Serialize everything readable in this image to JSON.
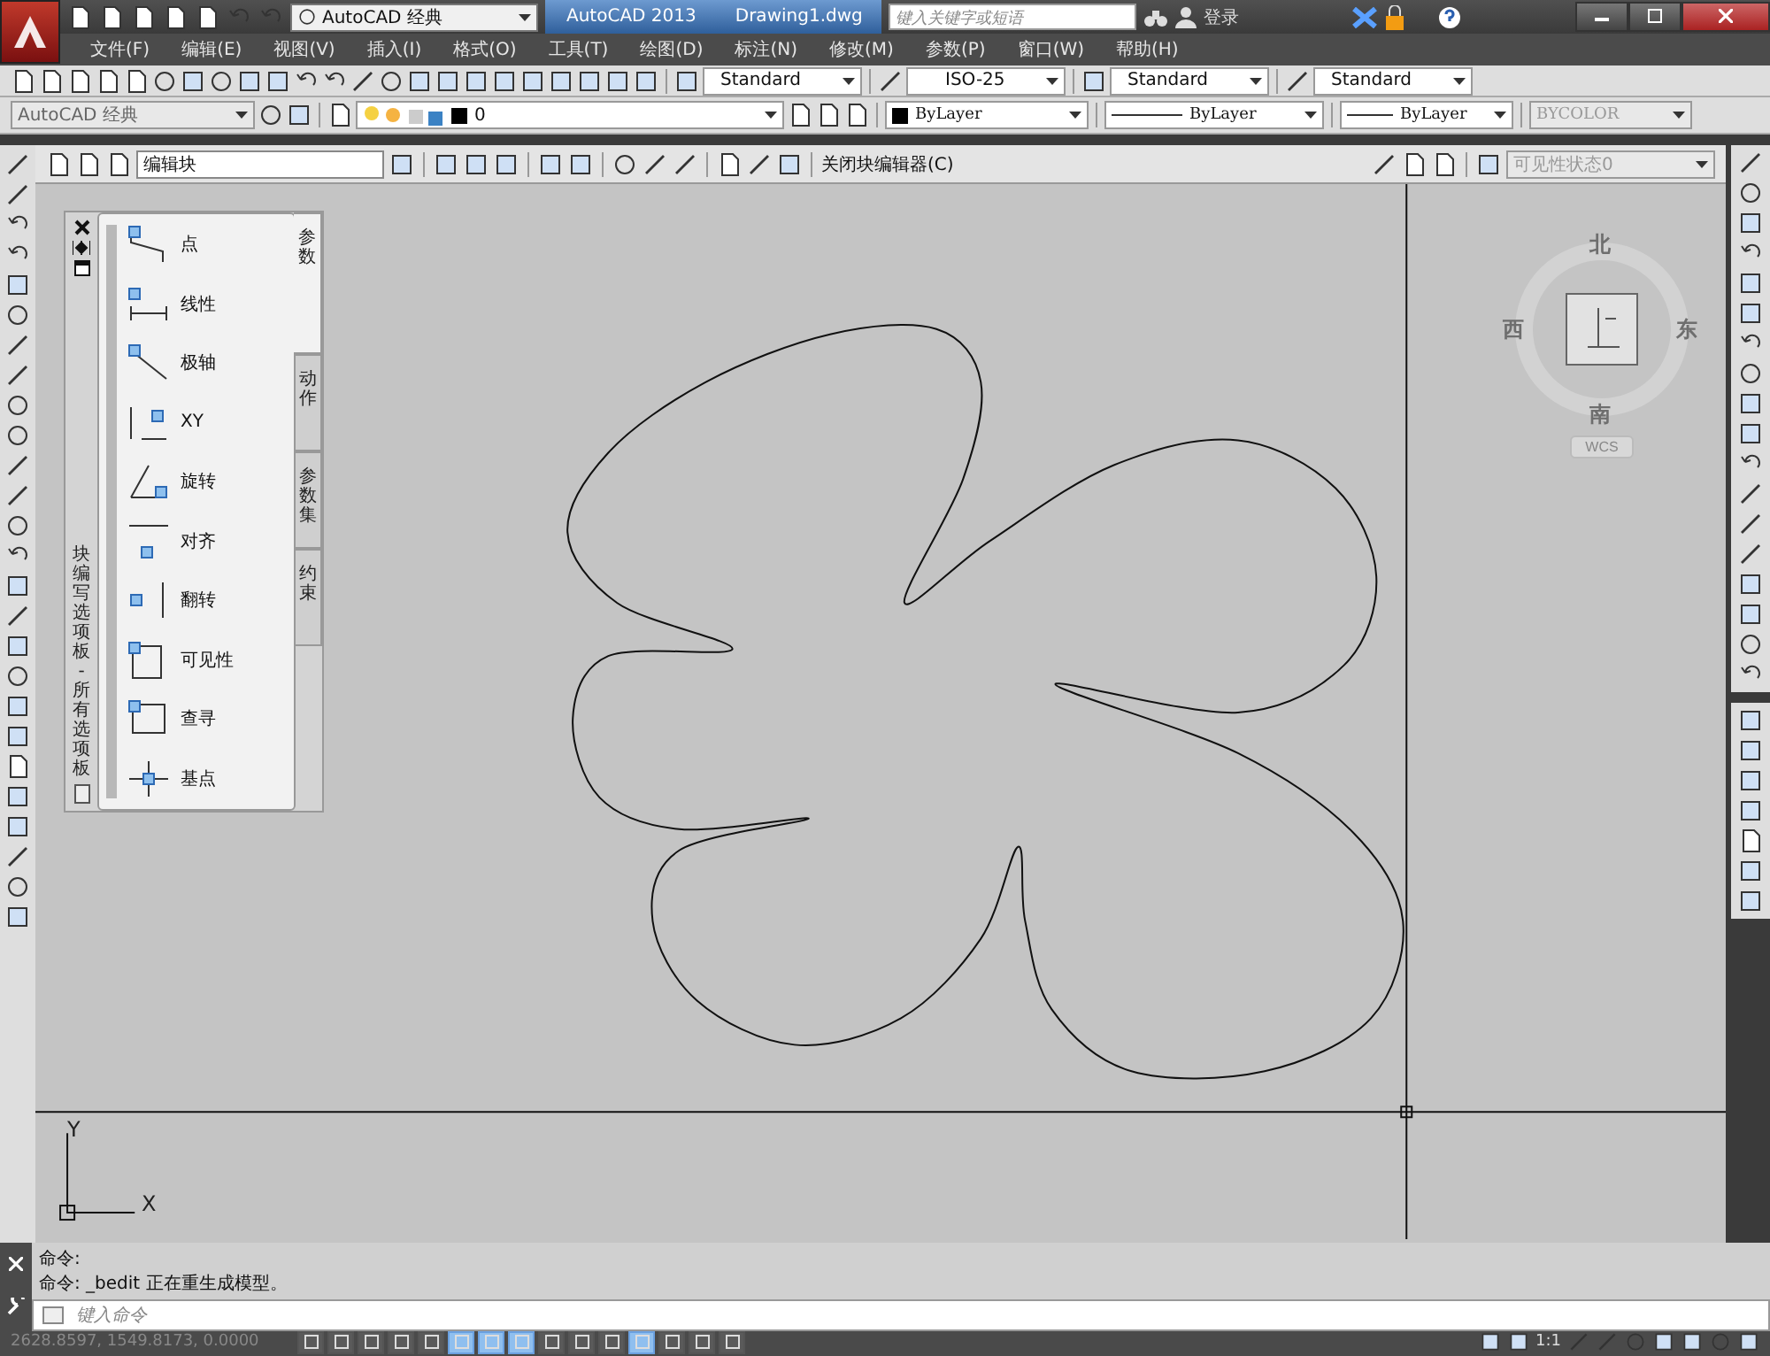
{
  "title_bar": {
    "workspace": "AutoCAD 经典",
    "app_title": "AutoCAD 2013",
    "file_name": "Drawing1.dwg",
    "search": {
      "placeholder": "键入关键字或短语"
    },
    "login": "登录"
  },
  "menu": [
    "文件(F)",
    "编辑(E)",
    "视图(V)",
    "插入(I)",
    "格式(O)",
    "工具(T)",
    "绘图(D)",
    "标注(N)",
    "修改(M)",
    "参数(P)",
    "窗口(W)",
    "帮助(H)"
  ],
  "style_dropdowns": [
    "Standard",
    "ISO-25",
    "Standard",
    "Standard"
  ],
  "properties_bar": {
    "workspace": "AutoCAD 经典",
    "layer": "0",
    "color_setting": "ByLayer",
    "linetype": "ByLayer",
    "lineweight": "ByLayer",
    "plot_style": {
      "value": "BYCOLOR",
      "disabled": true
    }
  },
  "block_editor": {
    "block_name": "编辑块",
    "close_label": "关闭块编辑器(C)",
    "visibility_state": {
      "value": "可见性状态0",
      "disabled": true
    }
  },
  "palette": {
    "title": "块编写选项板 - 所有选项板",
    "items": [
      {
        "label": "点"
      },
      {
        "label": "线性"
      },
      {
        "label": "极轴"
      },
      {
        "label": "XY"
      },
      {
        "label": "旋转"
      },
      {
        "label": "对齐"
      },
      {
        "label": "翻转"
      },
      {
        "label": "可见性"
      },
      {
        "label": "查寻"
      },
      {
        "label": "基点"
      }
    ],
    "tabs": [
      {
        "label": "参数",
        "selected": true
      },
      {
        "label": "动作",
        "selected": false
      },
      {
        "label": "参数集",
        "selected": false
      },
      {
        "label": "约束",
        "selected": false
      }
    ]
  },
  "viewcube": {
    "north": "北",
    "south": "南",
    "east": "东",
    "west": "西",
    "wcs": "WCS"
  },
  "ucs": {
    "x": "X",
    "y": "Y"
  },
  "command": {
    "history": [
      "命令:",
      "命令: _bedit 正在重生成模型。"
    ],
    "placeholder": "键入命令"
  },
  "status_bar": {
    "coordinates": "2628.8597, 1549.8173, 0.0000",
    "scale": "1:1",
    "toggles": [
      {
        "on": false
      },
      {
        "on": false
      },
      {
        "on": false
      },
      {
        "on": false
      },
      {
        "on": false
      },
      {
        "on": true
      },
      {
        "on": true
      },
      {
        "on": true
      },
      {
        "on": false
      },
      {
        "on": false
      },
      {
        "on": false
      },
      {
        "on": true
      },
      {
        "on": false
      },
      {
        "on": false
      },
      {
        "on": false
      }
    ]
  }
}
